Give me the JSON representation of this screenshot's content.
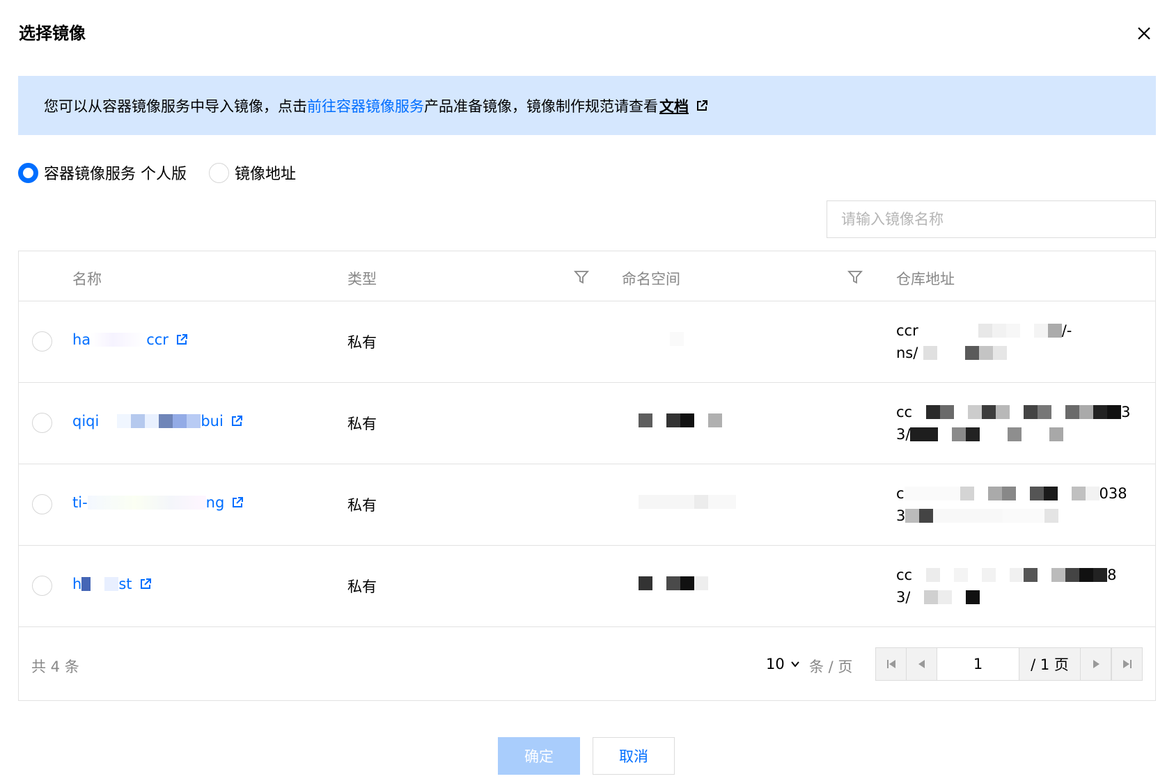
{
  "dialog": {
    "title": "选择镜像",
    "close_icon": "close-icon"
  },
  "notice": {
    "text_before": "您可以从容器镜像服务中导入镜像，点击",
    "link_text": "前往容器镜像服务",
    "text_middle": "产品准备镜像，镜像制作规范请查看",
    "doc_link_text": "文档"
  },
  "source_options": [
    {
      "label": "容器镜像服务 个人版",
      "checked": true
    },
    {
      "label": "镜像地址",
      "checked": false
    }
  ],
  "search": {
    "placeholder": "请输入镜像名称",
    "value": ""
  },
  "table": {
    "columns": {
      "name": "名称",
      "type": "类型",
      "namespace": "命名空间",
      "repo": "仓库地址"
    },
    "rows": [
      {
        "name_start": "ha",
        "name_end": "ccr",
        "type": "私有",
        "repo_line1_start": "ccr",
        "repo_line1_end": "/-",
        "repo_line2_start": "ns/"
      },
      {
        "name_start": "qiqi",
        "name_end": "bui",
        "type": "私有",
        "repo_line1_start": "cc",
        "repo_line1_end": "3",
        "repo_line2_start": "3/"
      },
      {
        "name_start": "ti-",
        "name_end": "ng",
        "type": "私有",
        "repo_line1_start": "c",
        "repo_line1_end": "038",
        "repo_line2_start": "3"
      },
      {
        "name_start": "h",
        "name_end": "st",
        "type": "私有",
        "repo_line1_start": "cc",
        "repo_line1_end": "8",
        "repo_line2_start": "3/"
      }
    ]
  },
  "footer": {
    "total_text": "共 4 条",
    "page_size": "10",
    "page_size_unit": "条 / 页",
    "current_page": "1",
    "total_pages_text": "/ 1 页"
  },
  "buttons": {
    "confirm": "确定",
    "cancel": "取消"
  },
  "colors": {
    "accent": "#006eff",
    "notice_bg": "#d5e7fe",
    "disabled_btn": "#a9cdfc"
  }
}
